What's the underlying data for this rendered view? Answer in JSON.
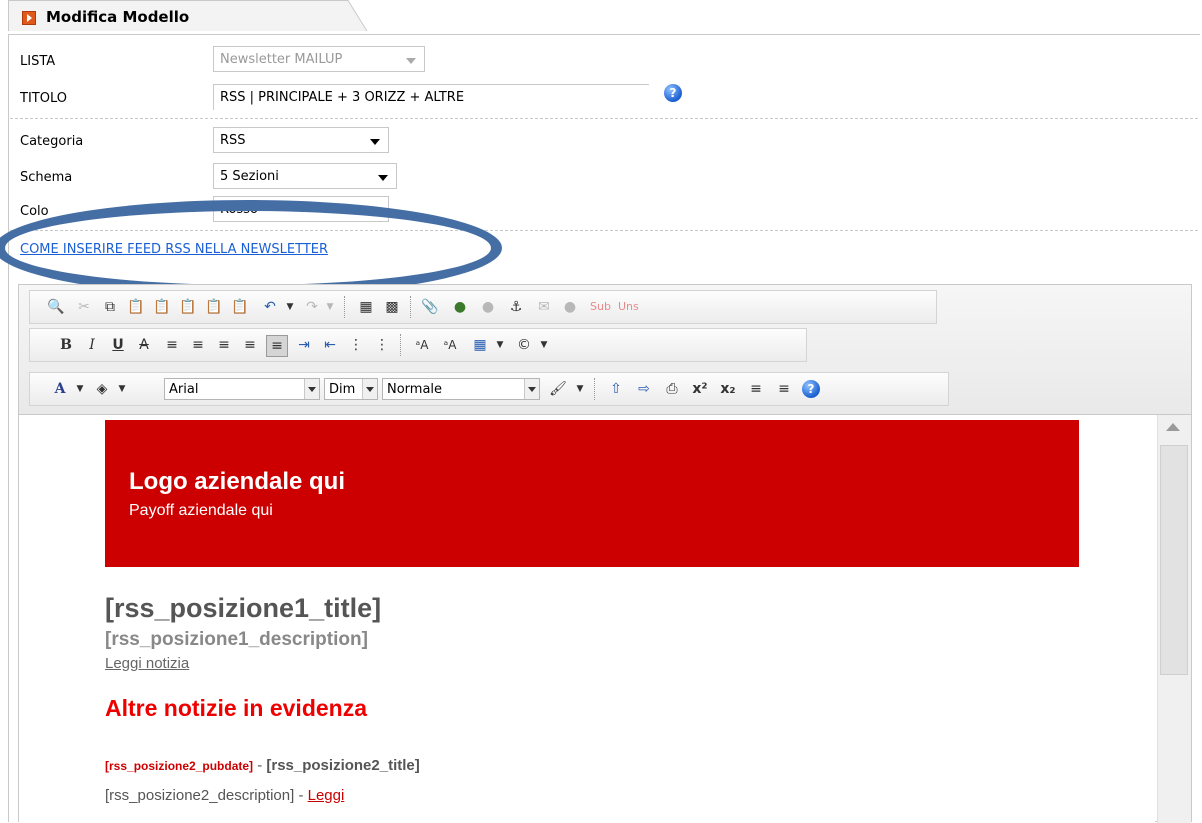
{
  "tab": {
    "title": "Modifica Modello"
  },
  "form": {
    "lista_label": "LISTA",
    "lista_value": "Newsletter MAILUP",
    "titolo_label": "TITOLO",
    "titolo_value": "RSS | PRINCIPALE + 3 ORIZZ + ALTRE",
    "categoria_label": "Categoria",
    "categoria_value": "RSS",
    "schema_label": "Schema",
    "schema_value": "5 Sezioni",
    "colore_label": "Colo",
    "colore_value": "Rosso",
    "help_glyph": "?",
    "link_text": "COME INSERIRE FEED RSS NELLA NEWSLETTER"
  },
  "toolbar": {
    "font_value": "Arial",
    "size_value": "Dim",
    "format_value": "Normale",
    "sub_label": "Sub",
    "uns_label": "Uns",
    "bold": "B",
    "italic": "I",
    "underline": "U",
    "strike": "A",
    "text_color": "A",
    "superscript": "x²",
    "subscript": "x₂"
  },
  "content": {
    "logo": "Logo aziendale qui",
    "payoff": "Payoff aziendale qui",
    "rss_title": "[rss_posizione1_title]",
    "rss_description": "[rss_posizione1_description]",
    "leggi_notizia": "Leggi notizia",
    "altre": "Altre notizie in evidenza",
    "pos2_pubdate": "[rss_posizione2_pubdate]",
    "pos2_sep": " - ",
    "pos2_title": "[rss_posizione2_title]",
    "pos2_description": "[rss_posizione2_description]",
    "pos2_sep2": " - ",
    "leggi": "Leggi"
  },
  "colors": {
    "banner": "#cc0000",
    "accent": "#ee0000",
    "link": "#1a5fd6",
    "annotation": "#456ea4"
  },
  "icons": [
    "find-icon",
    "cut-icon",
    "copy-icon",
    "paste-icon",
    "paste-text-icon",
    "paste-word-icon",
    "undo-icon",
    "redo-icon",
    "image-icon",
    "flash-icon",
    "link-icon",
    "unlink-icon",
    "anchor-icon",
    "table-icon",
    "special-char-icon",
    "help-icon"
  ]
}
